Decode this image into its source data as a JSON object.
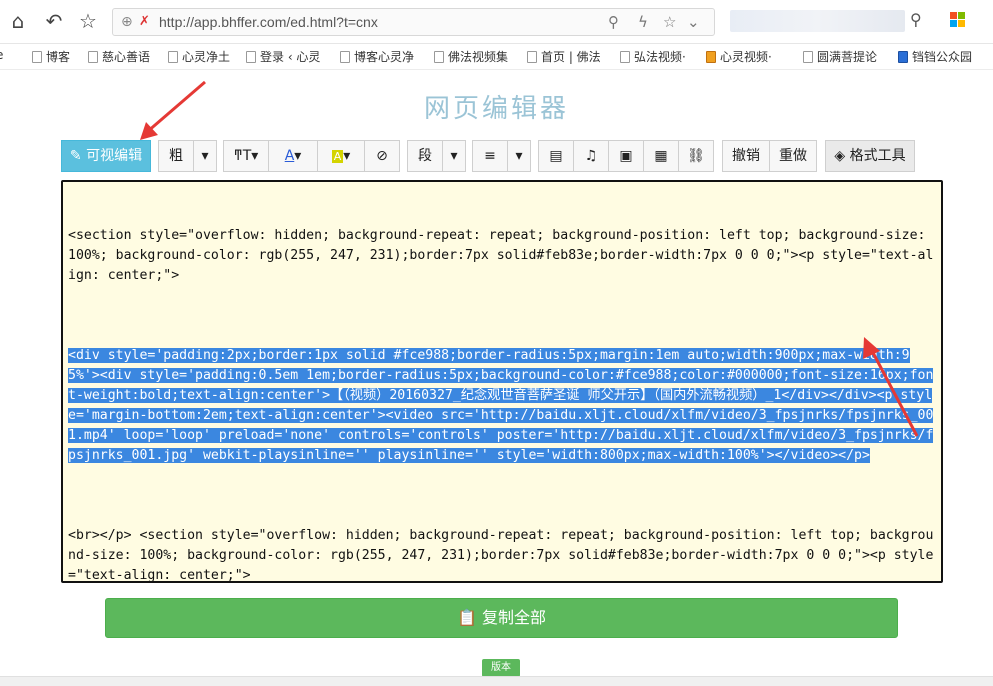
{
  "browser": {
    "url": "http://app.bhffer.com/ed.html?t=cnx",
    "bookmarks": [
      "博客",
      "慈心善语",
      "心灵净土",
      "登录 ‹ 心灵",
      "博客心灵净",
      "佛法视频集",
      "首页 | 佛法",
      "弘法视频·",
      "心灵视频·",
      "圆满菩提论",
      "铛铛公众园"
    ]
  },
  "page": {
    "title": "网页编辑器"
  },
  "toolbar": {
    "visual_edit": "可视编辑",
    "bold": "粗",
    "paragraph": "段",
    "undo": "撤销",
    "redo": "重做",
    "format_tool": "格式工具"
  },
  "editor": {
    "para1": "<section style=\"overflow: hidden; background-repeat: repeat; background-position: left top; background-size: 100%; background-color: rgb(255, 247, 231);border:7px solid#feb83e;border-width:7px 0 0 0;\"><p style=\"text-align: center;\">",
    "selected": "<div style='padding:2px;border:1px solid #fce988;border-radius:5px;margin:1em auto;width:900px;max-width:95%'><div style='padding:0.5em 1em;border-radius:5px;background-color:#fce988;color:#000000;font-size:16px;font-weight:bold;text-align:center'>【（视频）20160327_纪念观世音菩萨圣诞 师父开示】（国内外流畅视频）_1</div></div><p style='margin-bottom:2em;text-align:center'><video src='http://baidu.xljt.cloud/xlfm/video/3_fpsjnrks/fpsjnrks_001.mp4' loop='loop' preload='none' controls='controls' poster='http://baidu.xljt.cloud/xlfm/video/3_fpsjnrks/fpsjnrks_001.jpg' webkit-playsinline='' playsinline='' style='width:800px;max-width:100%'></video></p>",
    "para3": "<br></p> <section style=\"overflow: hidden; background-repeat: repeat; background-position: left top; background-size: 100%; background-color: rgb(255, 247, 231);border:7px solid#feb83e;border-width:7px 0 0 0;\"><p style=\"text-align: center;\">"
  },
  "actions": {
    "copy_all": "复制全部",
    "version": "版本"
  },
  "colors": {
    "primary": "#5bc0de",
    "success": "#5cb85c",
    "selection": "#3b87e0",
    "editor_bg": "#fffce2",
    "arrow": "#e53935"
  }
}
